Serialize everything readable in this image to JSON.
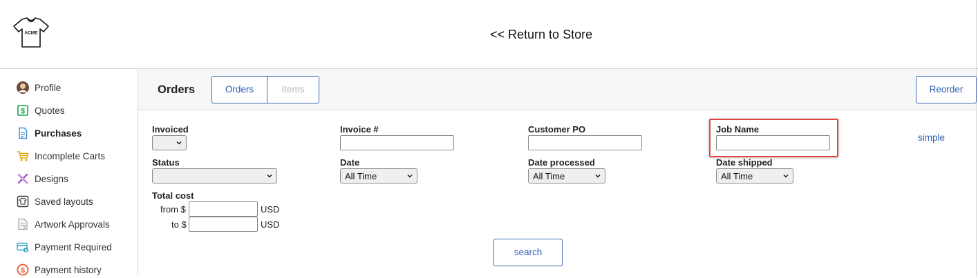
{
  "header": {
    "logo_text": "ACME",
    "return_link": "<< Return to Store"
  },
  "sidebar": {
    "items": [
      {
        "label": "Profile",
        "icon": "avatar-icon"
      },
      {
        "label": "Quotes",
        "icon": "dollar-document-icon"
      },
      {
        "label": "Purchases",
        "icon": "document-lines-icon",
        "active": true
      },
      {
        "label": "Incomplete Carts",
        "icon": "cart-icon"
      },
      {
        "label": "Designs",
        "icon": "design-tools-icon"
      },
      {
        "label": "Saved layouts",
        "icon": "shirt-frame-icon"
      },
      {
        "label": "Artwork Approvals",
        "icon": "approval-document-icon"
      },
      {
        "label": "Payment Required",
        "icon": "payment-card-icon"
      },
      {
        "label": "Payment history",
        "icon": "dollar-history-icon"
      }
    ]
  },
  "main": {
    "title": "Orders",
    "tabs": [
      {
        "label": "Orders",
        "selected": true
      },
      {
        "label": "Items",
        "selected": false
      }
    ],
    "reorder_label": "Reorder",
    "simple_link": "simple",
    "search_label": "search"
  },
  "filters": {
    "invoiced": {
      "label": "Invoiced",
      "value": ""
    },
    "invoice_no": {
      "label": "Invoice #",
      "value": ""
    },
    "customer_po": {
      "label": "Customer PO",
      "value": ""
    },
    "job_name": {
      "label": "Job Name",
      "value": ""
    },
    "status": {
      "label": "Status",
      "value": ""
    },
    "date": {
      "label": "Date",
      "value": "All Time"
    },
    "date_processed": {
      "label": "Date processed",
      "value": "All Time"
    },
    "date_shipped": {
      "label": "Date shipped",
      "value": "All Time"
    },
    "total_cost": {
      "label": "Total cost",
      "from_label": "from $",
      "to_label": "to $",
      "currency": "USD",
      "from_value": "",
      "to_value": ""
    }
  },
  "colors": {
    "accent": "#2e5fb0",
    "highlight": "#e04545",
    "border": "#d6d6d6"
  }
}
